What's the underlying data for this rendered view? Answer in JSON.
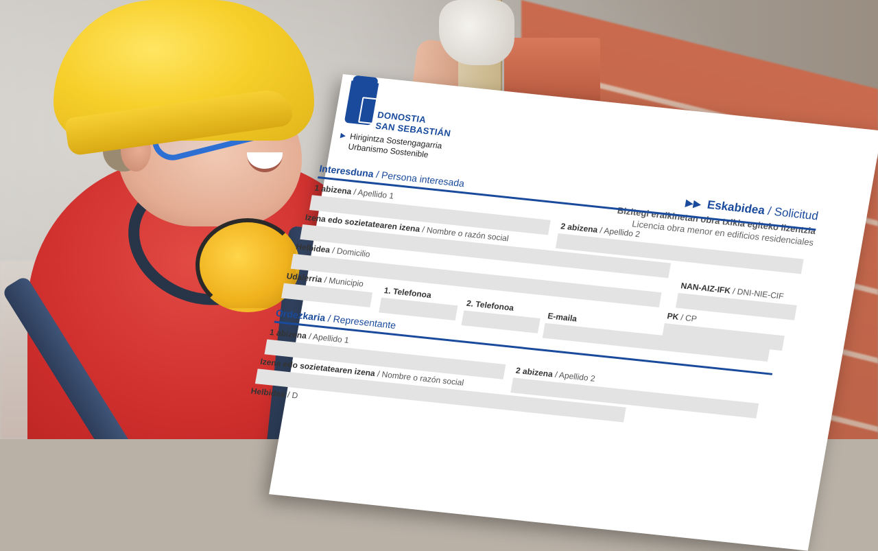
{
  "header": {
    "city_line1": "DONOSTIA",
    "city_line2": "SAN SEBASTIÁN",
    "department_line1": "Hirigintza Sostengagarria",
    "department_line2": "Urbanismo Sostenible"
  },
  "request": {
    "title_eu": "Eskabidea",
    "title_es": "/ Solicitud",
    "subtitle_eu": "Bizitegi eraikinetan obra txikia egiteko lizentzia",
    "subtitle_es": "Licencia obra menor en edificios residenciales"
  },
  "sections": {
    "applicant": {
      "title_eu": "Interesduna",
      "title_es": "/ Persona interesada",
      "fields": {
        "surname1": {
          "eu": "1 abizena",
          "es": "/ Apellido 1"
        },
        "surname2": {
          "eu": "2 abizena",
          "es": "/ Apellido 2"
        },
        "name": {
          "eu": "Izena edo sozietatearen izena",
          "es": "/ Nombre o razón social"
        },
        "address": {
          "eu": "Helbidea",
          "es": "/ Domicilio"
        },
        "id": {
          "eu": "NAN-AIZ-IFK",
          "es": "/ DNI-NIE-CIF"
        },
        "municipality": {
          "eu": "Udalerria",
          "es": "/ Municipio"
        },
        "phone1": {
          "eu": "1. Telefonoa",
          "es": ""
        },
        "phone2": {
          "eu": "2. Telefonoa",
          "es": ""
        },
        "postal": {
          "eu": "PK",
          "es": "/ CP"
        },
        "email": {
          "eu": "E-maila",
          "es": ""
        }
      }
    },
    "representative": {
      "title_eu": "Ordezkaria",
      "title_es": "/ Representante",
      "fields": {
        "surname1": {
          "eu": "1 abizena",
          "es": "/ Apellido 1"
        },
        "surname2": {
          "eu": "2 abizena",
          "es": "/ Apellido 2"
        },
        "name": {
          "eu": "Izena edo sozietatearen izena",
          "es": "/ Nombre o razón social"
        },
        "address": {
          "eu": "Helbidea",
          "es": "/ D"
        }
      }
    }
  },
  "colors": {
    "brand_blue": "#1a4a9c",
    "field_gray": "#e3e3e3"
  }
}
